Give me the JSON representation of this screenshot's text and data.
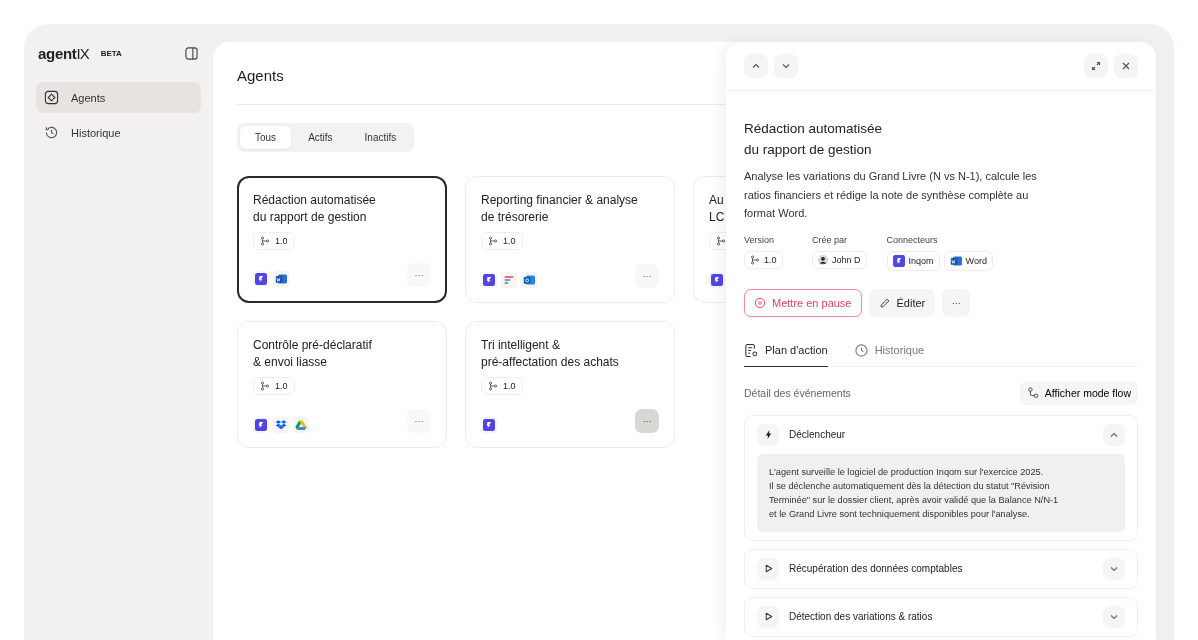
{
  "sidebar": {
    "brand": "agent",
    "brand_mark": "IX",
    "badge": "BETA",
    "items": [
      {
        "label": "Agents",
        "selected": true
      },
      {
        "label": "Historique",
        "selected": false
      }
    ]
  },
  "page": {
    "title": "Agents",
    "filters": [
      {
        "label": "Tous",
        "selected": true
      },
      {
        "label": "Actifs",
        "selected": false
      },
      {
        "label": "Inactifs",
        "selected": false
      }
    ],
    "cards": [
      {
        "title_lines": [
          "Rédaction automatisée",
          "du rapport de gestion"
        ],
        "version": "1.0",
        "connectors": [
          {
            "kind": "inqom"
          },
          {
            "kind": "word"
          }
        ],
        "selected": true,
        "menu_hover": false
      },
      {
        "title_lines": [
          "Reporting financier & analyse",
          "de trésorerie"
        ],
        "version": "1.0",
        "connectors": [
          {
            "kind": "inqom"
          },
          {
            "kind": "tasks"
          },
          {
            "kind": "outlook"
          }
        ],
        "selected": false,
        "menu_hover": false
      },
      {
        "title_lines": [
          "Au",
          "LC"
        ],
        "connectors": [
          {
            "kind": "inqom"
          }
        ],
        "selected": false
      },
      {
        "title_lines": [
          "Contrôle pré-déclaratif",
          "& envoi liasse"
        ],
        "version": "1.0",
        "connectors": [
          {
            "kind": "inqom"
          },
          {
            "kind": "dropbox"
          },
          {
            "kind": "gdrive"
          }
        ],
        "selected": false,
        "menu_hover": false
      },
      {
        "title_lines": [
          "Tri intelligent &",
          "pré-affectation des achats"
        ],
        "version": "1.0",
        "connectors": [
          {
            "kind": "inqom"
          }
        ],
        "selected": false,
        "menu_hover": true
      }
    ]
  },
  "detail": {
    "title_lines": [
      "Rédaction automatisée",
      "du rapport de gestion"
    ],
    "description": "Analyse les variations du Grand Livre (N vs N-1), calcule les ratios financiers et rédige la note de synthèse complète au format Word.",
    "meta": [
      {
        "label": "Version",
        "chips": [
          {
            "text": "1.0",
            "kind": "branch"
          }
        ]
      },
      {
        "label": "Crée par",
        "chips": [
          {
            "text": "John D",
            "kind": "avatar"
          }
        ]
      },
      {
        "label": "Connecteurs",
        "chips": [
          {
            "text": "Inqom",
            "kind": "inqom"
          },
          {
            "text": "Word",
            "kind": "word"
          }
        ]
      }
    ],
    "pause_button": "Mettre en pause",
    "edit_button": "Éditer",
    "more_button": "···",
    "tabs": [
      {
        "label": "Plan d'action",
        "selected": true
      },
      {
        "label": "Historique",
        "selected": false
      }
    ],
    "events_label": "Détail des événements",
    "flow_button": "Afficher mode flow",
    "steps": [
      {
        "title": "Déclencheur",
        "kind": "trigger",
        "expanded": true,
        "body": "L'agent surveille le logiciel de production Inqom sur l'exercice 2025.\nIl se déclenche automatiquement dès la détection du statut \"Révision Terminée\" sur le dossier client, après avoir validé que la Balance N/N-1\net le Grand Livre sont techniquement disponibles pour l'analyse."
      },
      {
        "title": "Récupération des données comptables",
        "kind": "action",
        "expanded": false
      },
      {
        "title": "Détection des variations & ratios",
        "kind": "action",
        "expanded": false
      }
    ]
  },
  "card_menu": "···"
}
